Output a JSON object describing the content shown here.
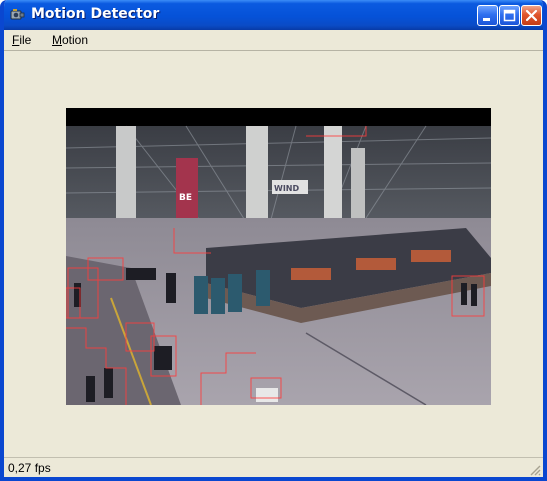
{
  "window": {
    "title": "Motion Detector"
  },
  "menu": {
    "file": {
      "accel": "F",
      "rest": "ile"
    },
    "motion": {
      "accel": "M",
      "rest": "otion"
    }
  },
  "video": {
    "signage": "WIND",
    "sign_side": "BE"
  },
  "status": {
    "fps": "0,27 fps"
  },
  "colors": {
    "title_blue": "#0552d8",
    "close_red": "#e0552c",
    "face": "#ece9d8",
    "motion_box": "#ff3b3b"
  }
}
